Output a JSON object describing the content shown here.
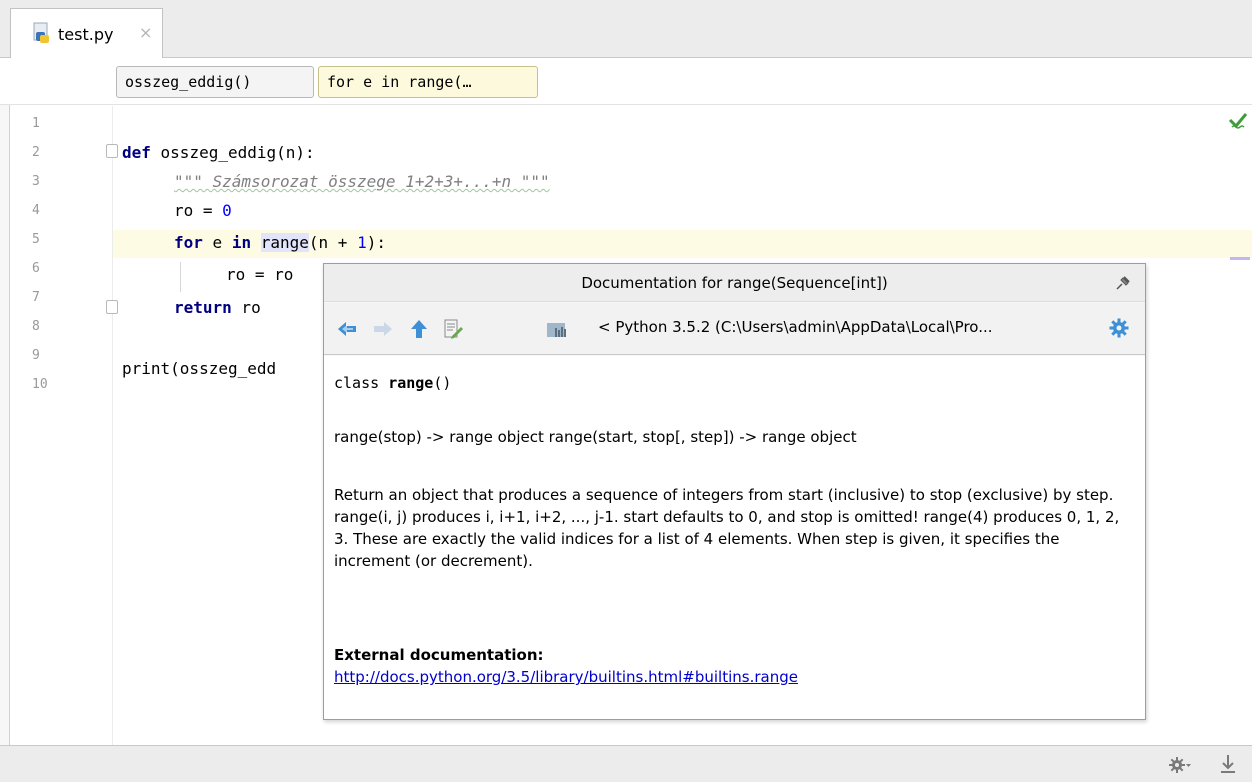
{
  "tab": {
    "label": "test.py",
    "close": "×"
  },
  "breadcrumbs": [
    {
      "label": "osszeg_eddig()"
    },
    {
      "label": "for e in range(…"
    }
  ],
  "gutter": {
    "line_numbers": [
      "1",
      "2",
      "3",
      "4",
      "5",
      "6",
      "7",
      "8",
      "9",
      "10"
    ]
  },
  "code": {
    "l2_kw": "def",
    "l2_rest": " osszeg_eddig(n):",
    "l3_doc": "\"\"\" Számsorozat összege 1+2+3+...+n \"\"\"",
    "l4_a": "ro = ",
    "l4_num": "0",
    "l5_kw1": "for",
    "l5_e": " e ",
    "l5_kw2": "in",
    "l5_sp": " ",
    "l5_range": "range",
    "l5_b": "(n + ",
    "l5_num": "1",
    "l5_c": "):",
    "l6": "ro = ro",
    "l7_kw": "return",
    "l7_rest": " ro",
    "l9": "print(osszeg_edd"
  },
  "popup": {
    "title": "Documentation for range(Sequence[int])",
    "path": "< Python 3.5.2 (C:\\Users\\admin\\AppData\\Local\\Pro...",
    "sig_kw": "class",
    "sig_name": "range",
    "sig_paren": "()",
    "signature_line": "range(stop) -> range object range(start, stop[, step]) -> range object",
    "description": "Return an object that produces a sequence of integers from start (inclusive) to stop (exclusive) by step. range(i, j) produces i, i+1, i+2, ..., j-1. start defaults to 0, and stop is omitted! range(4) produces 0, 1, 2, 3. These are exactly the valid indices for a list of 4 elements. When step is given, it specifies the increment (or decrement).",
    "external_heading": "External documentation:",
    "external_link": "http://docs.python.org/3.5/library/builtins.html#builtins.range"
  },
  "colors": {
    "keyword": "#000080",
    "number": "#0000ff",
    "docstring": "#808080",
    "current_line": "#fdfbe4",
    "link": "#0000cc",
    "nav_blue": "#3d8fd6"
  },
  "icons": [
    "python-file-icon",
    "close-icon",
    "checkmark-icon",
    "back-arrow-icon",
    "forward-arrow-icon",
    "up-arrow-icon",
    "edit-source-icon",
    "library-icon",
    "settings-gear-icon",
    "pin-icon",
    "status-gear-icon",
    "status-pin-icon"
  ]
}
